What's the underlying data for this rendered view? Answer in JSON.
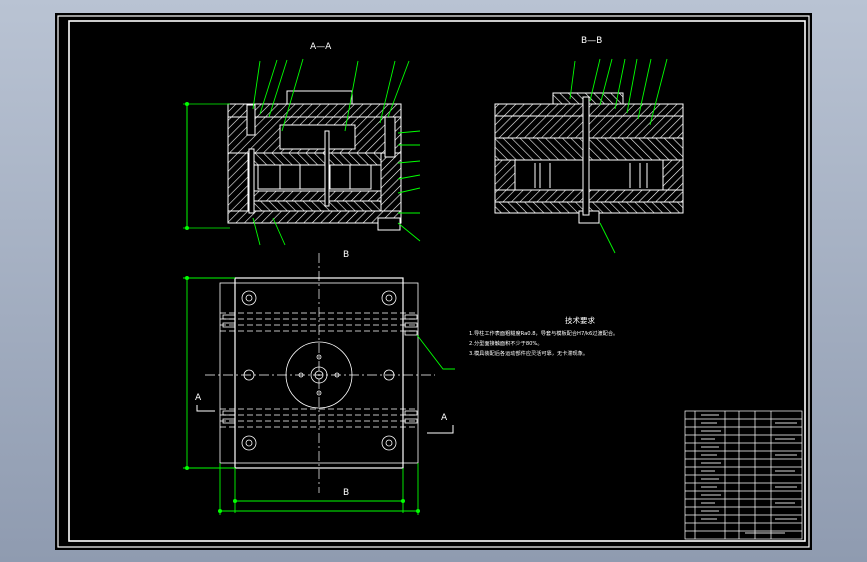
{
  "views": {
    "section_aa": "A—A",
    "section_bb": "B—B"
  },
  "cut_markers": {
    "b_top": "B",
    "b_bottom": "B",
    "a_left": "A",
    "a_right": "A"
  },
  "notes": {
    "heading": "技术要求",
    "lines": [
      "1.导柱工作表面粗糙度Ra0.8，导套与模板配合H7/k6过渡配合。",
      "2.分型面接触面积不少于80%。",
      "3.模具装配后各运动部件应灵活可靠，无卡滞现象。"
    ]
  },
  "colors": {
    "background": "#000000",
    "frame": "#ffffff",
    "leader": "#00ff00",
    "hatch": "#ffffff",
    "dim": "#00ff00"
  }
}
